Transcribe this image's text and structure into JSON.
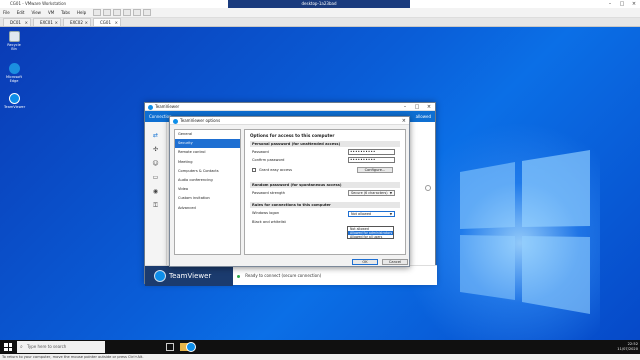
{
  "vmware": {
    "title": "CG01 - VMware Workstation",
    "menu": [
      "File",
      "Edit",
      "View",
      "VM",
      "Tabs",
      "Help"
    ],
    "rdp_title": "desktop-1a23bad",
    "tabs": [
      {
        "label": "DC01",
        "active": false
      },
      {
        "label": "EXC01",
        "active": false
      },
      {
        "label": "EXC02",
        "active": false
      },
      {
        "label": "CG01",
        "active": true
      }
    ],
    "status_text": "To return to your computer, move the mouse pointer outside or press Ctrl+Alt."
  },
  "desktop": {
    "icons": [
      {
        "label": "Recycle Bin",
        "icon": "recycle-bin-icon"
      },
      {
        "label": "Microsoft Edge",
        "icon": "edge-icon"
      },
      {
        "label": "TeamViewer",
        "icon": "teamviewer-icon"
      }
    ]
  },
  "teamviewer": {
    "title": "TeamViewer",
    "blue_bar_text": "Connection",
    "blue_bar_right": "allowed",
    "right_heading": "mputer",
    "brand": "TeamViewer",
    "status": "Ready to connect (secure connection)"
  },
  "options": {
    "title": "TeamViewer options",
    "categories": [
      {
        "label": "General",
        "selected": false
      },
      {
        "label": "Security",
        "selected": true
      },
      {
        "label": "Remote control",
        "selected": false
      },
      {
        "label": "Meeting",
        "selected": false
      },
      {
        "label": "Computers & Contacts",
        "selected": false
      },
      {
        "label": "Audio conferencing",
        "selected": false
      },
      {
        "label": "Video",
        "selected": false
      },
      {
        "label": "Custom invitation",
        "selected": false
      },
      {
        "label": "Advanced",
        "selected": false
      }
    ],
    "panel": {
      "heading": "Options for access to this computer",
      "personal_section": "Personal password (for unattended access)",
      "password_label": "Password",
      "password_value": "••••••••••",
      "confirm_label": "Confirm password",
      "confirm_value": "••••••••••",
      "easy_access_label": "Grant easy access",
      "configure_label": "Configure...",
      "random_section": "Random password (for spontaneous access)",
      "strength_label": "Password strength",
      "strength_value": "Secure (6 characters)",
      "rules_section": "Rules for connections to this computer",
      "windows_logon_label": "Windows logon",
      "windows_logon_value": "Not allowed",
      "windows_logon_options": [
        "Not allowed",
        "Allowed for administrators only",
        "Allowed for all users"
      ],
      "windows_logon_highlight": 1,
      "blacklist_label": "Black and whitelist"
    },
    "ok_label": "OK",
    "cancel_label": "Cancel"
  },
  "taskbar": {
    "search_placeholder": "Type here to search",
    "time": "22:52",
    "date": "11/07/2020"
  },
  "colors": {
    "accent": "#1e6fd2",
    "teamviewer_blue": "#0e6fd2",
    "brand_dark": "#1b3b6e",
    "status_green": "#2ca84a"
  }
}
